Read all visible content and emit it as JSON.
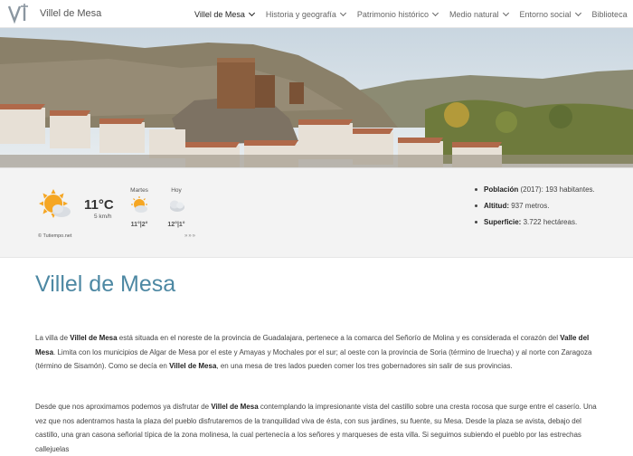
{
  "header": {
    "site_name": "Villel de Mesa",
    "menu": [
      {
        "label": "Villel de Mesa"
      },
      {
        "label": "Historia y geografía"
      },
      {
        "label": "Patrimonio histórico"
      },
      {
        "label": "Medio natural"
      },
      {
        "label": "Entorno social"
      },
      {
        "label": "Biblioteca"
      }
    ]
  },
  "weather": {
    "temp": "11°C",
    "wind": "5 km/h",
    "credit": "© Tutiempo.net",
    "days": [
      {
        "name": "Martes",
        "temps": "11°|2°"
      },
      {
        "name": "Hoy",
        "temps": "12°|1°"
      }
    ],
    "more": "»»»"
  },
  "facts": {
    "population_label": "Población",
    "population_year": "(2017):",
    "population_value": "193 habitantes.",
    "altitude_label": "Altitud:",
    "altitude_value": "937 metros.",
    "surface_label": "Superficie:",
    "surface_value": "3.722 hectáreas."
  },
  "content": {
    "title": "Villel de Mesa",
    "p1": {
      "s1": "La villa de ",
      "b1": "Villel de Mesa",
      "s2": " está situada en el noreste de la provincia de Guadalajara, pertenece a la comarca del Señorío de Molina y es considerada el corazón del ",
      "b2": "Valle del Mesa",
      "s3": ". Limita con los municipios de Algar de Mesa por el este y Amayas y Mochales por el sur; al oeste con la provincia de Soria (término de Iruecha) y al norte con Zaragoza (término de Sisamón).  Como se decía en ",
      "b3": "Villel de Mesa",
      "s4": ", en una mesa de tres lados pueden comer los tres gobernadores sin salir de sus provincias."
    },
    "p2": {
      "s1": "Desde que nos aproximamos podemos ya disfrutar de ",
      "b1": "Villel de Mesa",
      "s2": " contemplando la impresionante vista del castillo sobre una cresta rocosa que surge entre el caserío. Una vez que nos adentramos hasta la plaza del pueblo disfrutaremos de la tranquilidad viva de ésta, con sus jardines, su fuente, su Mesa. Desde la plaza se avista, debajo del castillo, una gran casona señorial típica de la zona molinesa, la cual pertenecía a los señores y marqueses de esta villa. Si seguimos subiendo el pueblo por las estrechas callejuelas"
    }
  }
}
